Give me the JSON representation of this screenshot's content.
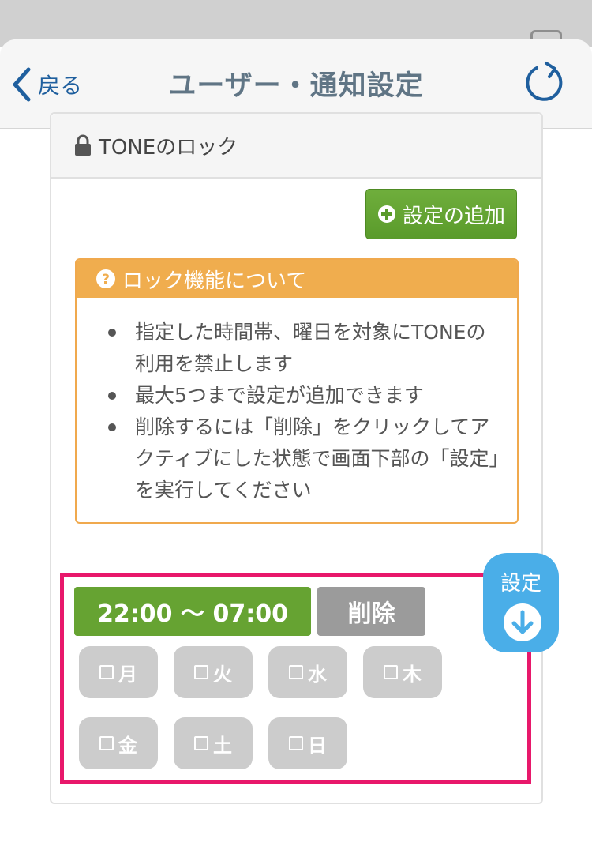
{
  "nav": {
    "back_label": "戻る",
    "title": "ユーザー・通知設定"
  },
  "card": {
    "title": "TONEのロック"
  },
  "add_button": {
    "label": "設定の追加"
  },
  "info": {
    "title": "ロック機能について",
    "items": [
      "指定した時間帯、曜日を対象にTONEの利用を禁止します",
      "最大5つまで設定が追加できます",
      "削除するには「削除」をクリックしてアクティブにした状態で画面下部の「設定」を実行してください"
    ]
  },
  "rule": {
    "time_range": "22:00 〜 07:00",
    "delete_label": "削除",
    "days": [
      "月",
      "火",
      "水",
      "木",
      "金",
      "土",
      "日"
    ]
  },
  "float_button": {
    "label": "設定"
  },
  "colors": {
    "nav_text": "#1f5f9e",
    "title_text": "#607585",
    "add_green": "#5a9b2b",
    "info_orange": "#f0ad4e",
    "time_green": "#66a332",
    "highlight": "#e8186b",
    "float_blue": "#4aaee8"
  },
  "icons": {
    "back": "chevron-left-icon",
    "refresh": "refresh-icon",
    "lock": "lock-icon",
    "add": "plus-circle-icon",
    "info": "question-circle-icon",
    "checkbox": "checkbox-icon",
    "arrow": "arrow-down-circle-icon"
  }
}
